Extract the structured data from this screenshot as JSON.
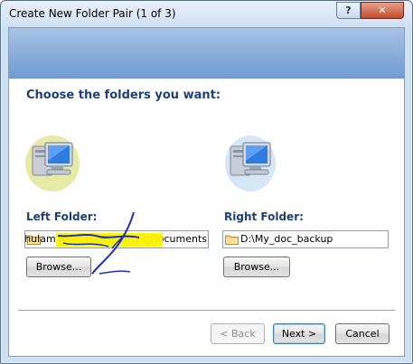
{
  "window": {
    "title": "Create New Folder Pair (1 of 3)"
  },
  "titlebar_buttons": {
    "help": "?",
    "close": "✕"
  },
  "page": {
    "heading": "Choose the folders you want:"
  },
  "left": {
    "label": "Left Folder:",
    "path": "ers\\Ghulam Mohi\\Bin Services\\Documents",
    "browse_label": "Browse..."
  },
  "right": {
    "label": "Right Folder:",
    "path": "D:\\My_doc_backup",
    "browse_label": "Browse..."
  },
  "footer": {
    "back_label": "< Back",
    "next_label": "Next >",
    "cancel_label": "Cancel"
  },
  "colors": {
    "heading": "#1e3f7a",
    "header_band": "#7ea3d6",
    "highlight": "#fff200",
    "scribble": "#1a2fc0"
  },
  "icons": {
    "left_computer": "computer-icon",
    "right_computer": "computer-icon",
    "folder": "folder-icon"
  }
}
